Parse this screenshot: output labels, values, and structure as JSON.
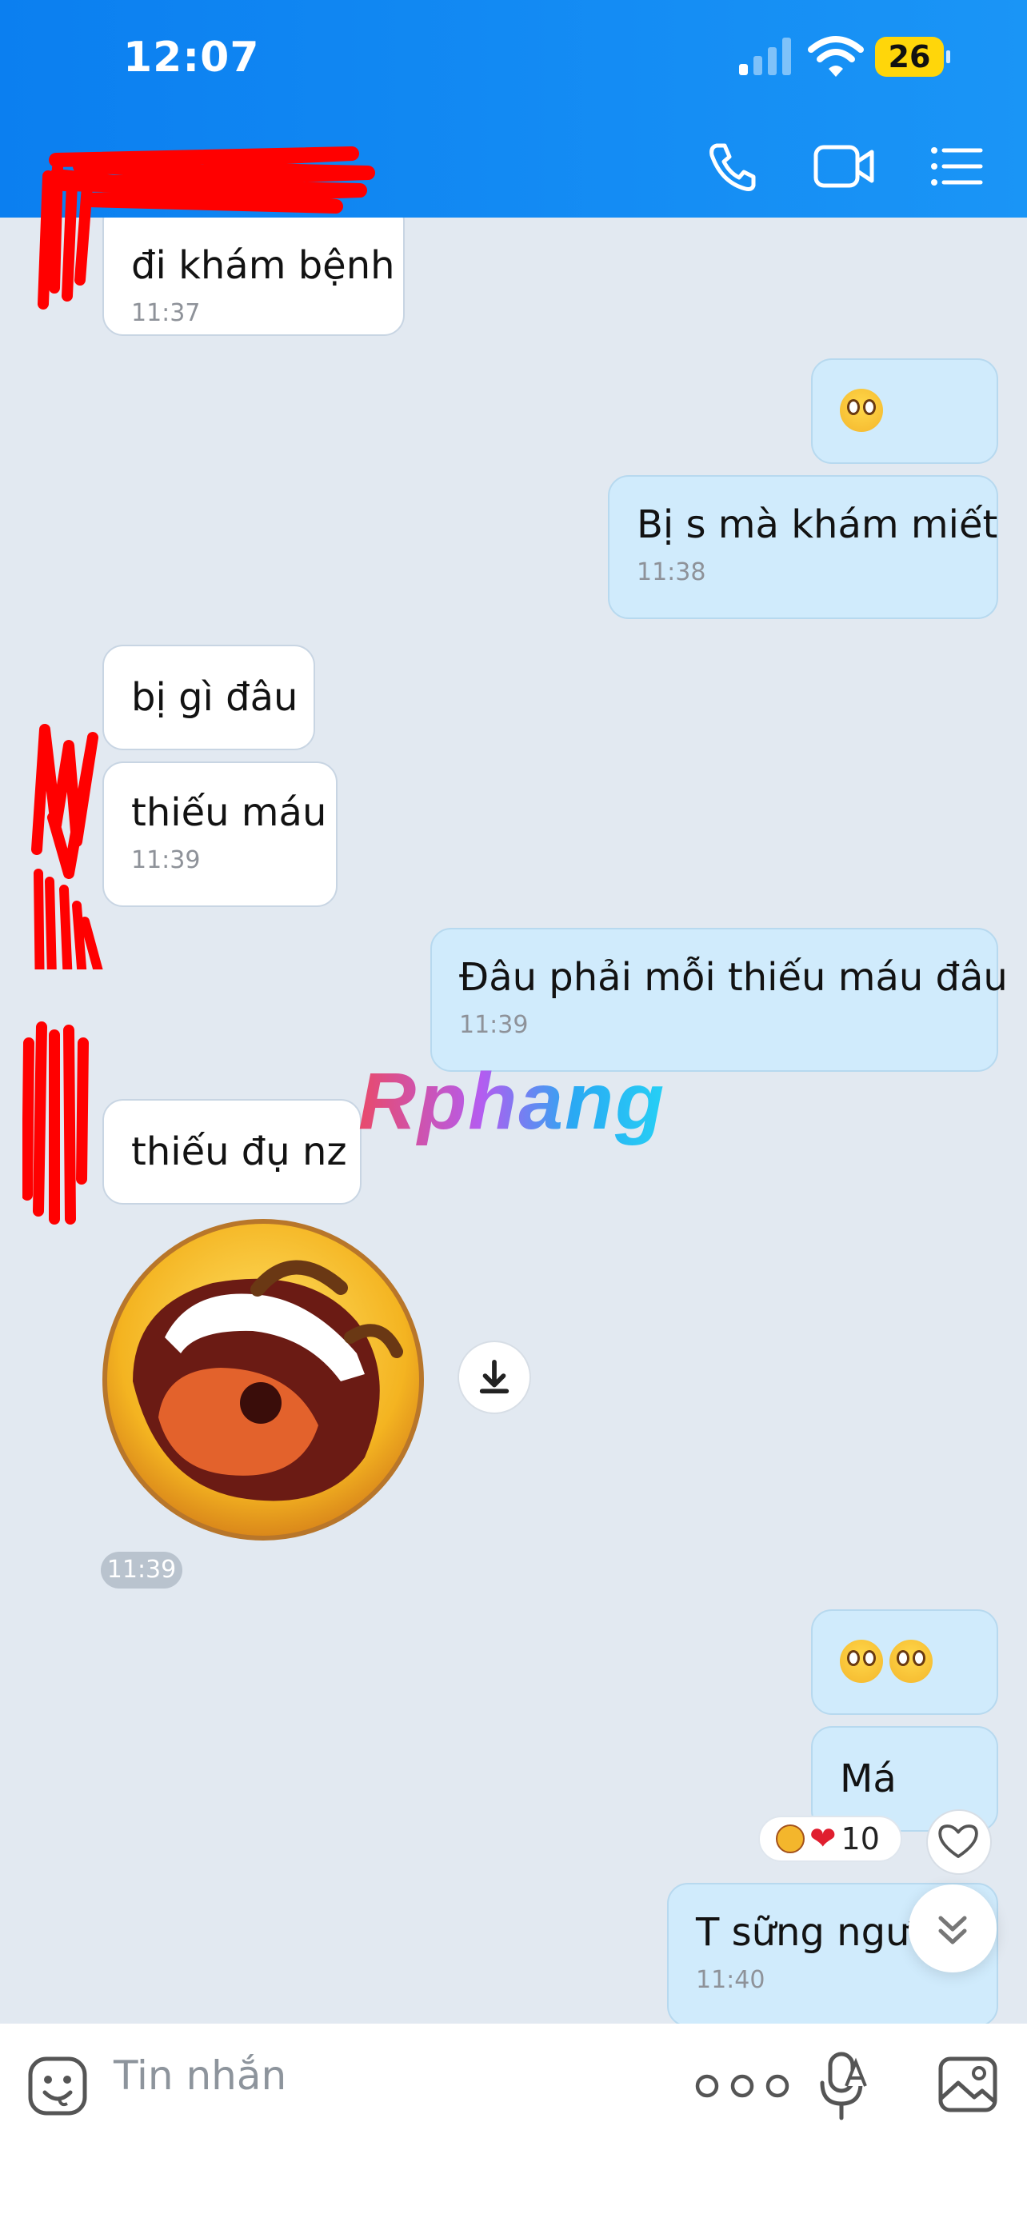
{
  "status_bar": {
    "time": "12:07",
    "battery": "26"
  },
  "header": {
    "icons": [
      "back-icon",
      "phone-icon",
      "video-call-icon",
      "menu-list-icon"
    ]
  },
  "messages": [
    {
      "side": "them",
      "text": "đi khám bệnh",
      "time": "11:37"
    },
    {
      "side": "me",
      "emoji": "flushed-face",
      "count": 1
    },
    {
      "side": "me",
      "text": "Bị s mà khám miết",
      "time": "11:38"
    },
    {
      "side": "them",
      "text": "bị gì đâu"
    },
    {
      "side": "them",
      "text": "thiếu máu",
      "time": "11:39"
    },
    {
      "side": "me",
      "text": "Đâu phải mỗi thiếu máu đâu",
      "time": "11:39"
    },
    {
      "side": "them",
      "text": "thiếu đụ nz"
    },
    {
      "side": "them",
      "sticker": "laughing-face-sticker",
      "time": "11:39"
    },
    {
      "side": "me",
      "emoji": "flushed-face",
      "count": 2
    },
    {
      "side": "me",
      "text": "Má",
      "reactions": {
        "count": "10"
      }
    },
    {
      "side": "me",
      "text": "T sững ngườ",
      "time": "11:40"
    }
  ],
  "watermark": "Rphang",
  "composer": {
    "placeholder": "Tin nhắn"
  },
  "colors": {
    "header": "#1a8ff5",
    "chat_bg": "#e2e9f1",
    "my_bubble": "#d0ebfc",
    "their_bubble": "#ffffff"
  }
}
